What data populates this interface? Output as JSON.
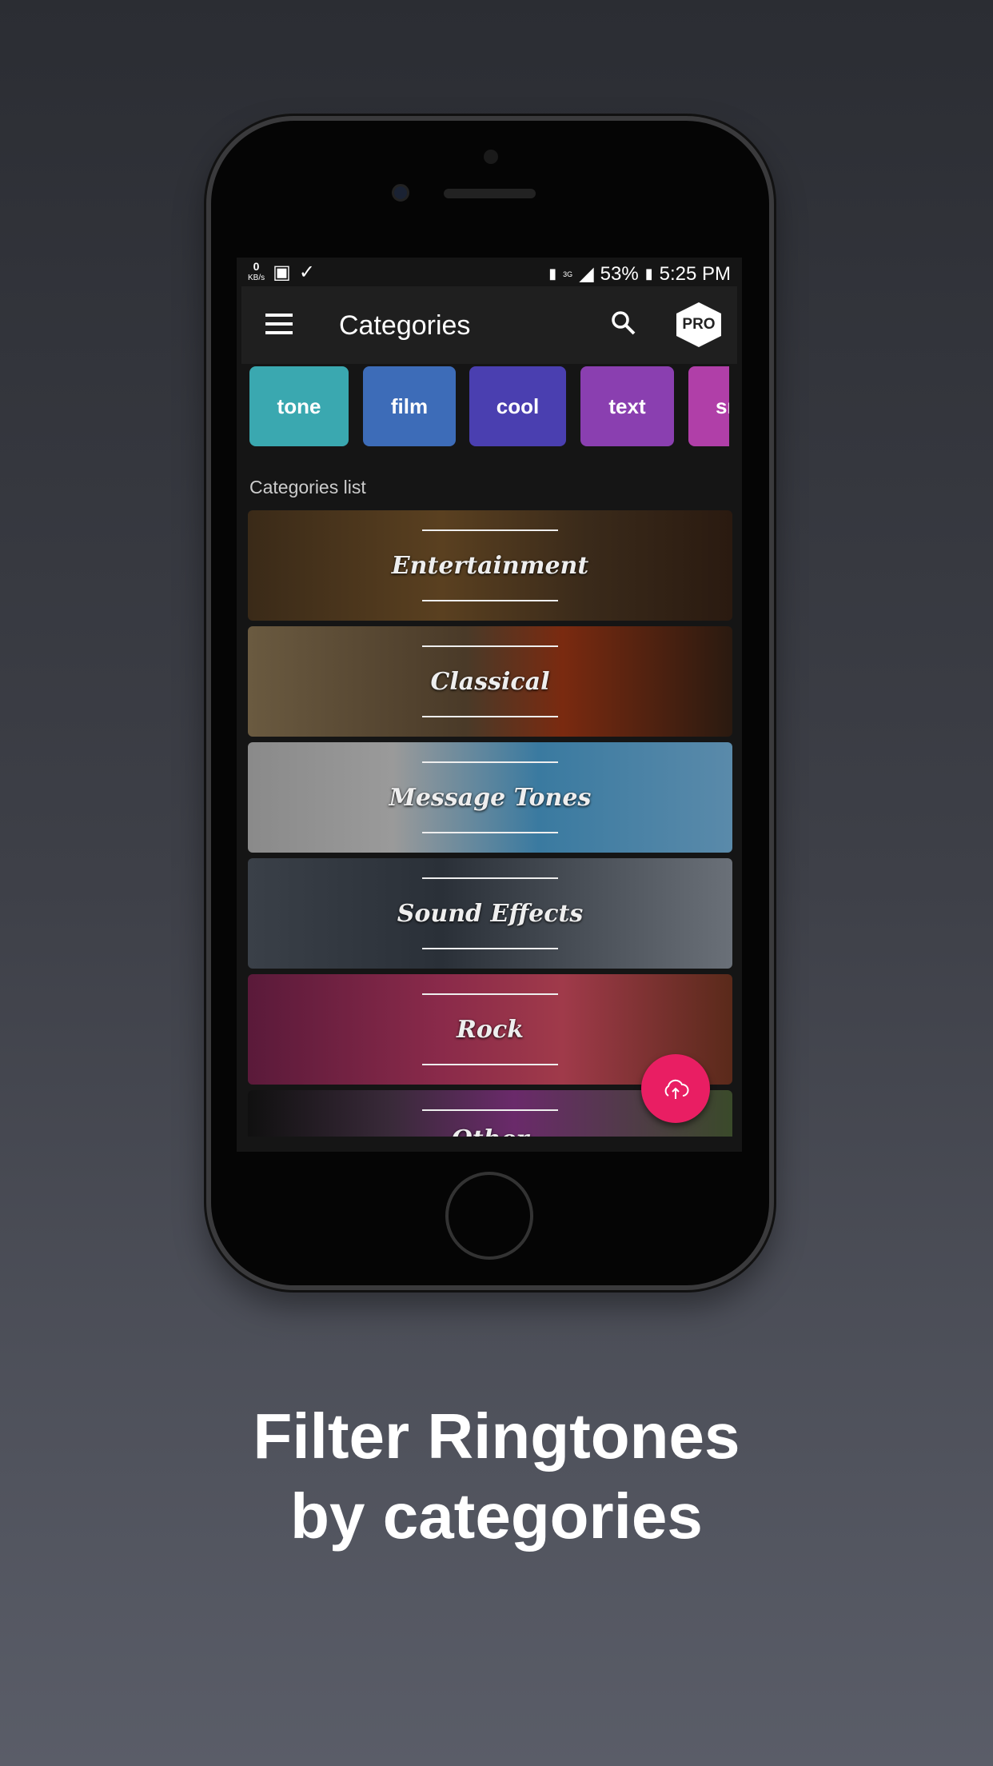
{
  "status": {
    "kbs": "0",
    "kbs_unit": "KB/s",
    "network": "3G",
    "battery": "53%",
    "time": "5:25 PM"
  },
  "toolbar": {
    "title": "Categories",
    "pro": "PRO"
  },
  "chips": [
    {
      "label": "tone",
      "color": "#3aa8b0"
    },
    {
      "label": "film",
      "color": "#3d6cb8"
    },
    {
      "label": "cool",
      "color": "#4a3fb0"
    },
    {
      "label": "text",
      "color": "#8a3fb0"
    },
    {
      "label": "sm",
      "color": "#b03fa8"
    }
  ],
  "section_label": "Categories list",
  "categories": [
    {
      "label": "Entertainment",
      "bg": "linear-gradient(90deg,#3a2a18,#5a4020 40%,#3a2a1a 70%,#2a1a10)"
    },
    {
      "label": "Classical",
      "bg": "linear-gradient(90deg,#6a5a40,#4a3a28 45%,#7a2a10 65%,#2a1a10)"
    },
    {
      "label": "Message Tones",
      "bg": "linear-gradient(90deg,#8a8a8a,#9a9a9a 30%,#3a7aa0 60%,#5a8aaa)"
    },
    {
      "label": "Sound Effects",
      "bg": "linear-gradient(90deg,#3a4048,#2a3038 40%,#4a5058 70%,#6a7078)"
    },
    {
      "label": "Rock",
      "bg": "linear-gradient(90deg,#5a1a3a,#8a2a4a 40%,#a03a4a 65%,#5a2a1a)"
    },
    {
      "label": "Other",
      "bg": "linear-gradient(90deg,#101010,#3a2a3a 30%,#6a2a6a 55%,#3a4a2a)"
    }
  ],
  "caption": {
    "line1": "Filter Ringtones",
    "line2": "by categories"
  },
  "colors": {
    "fab": "#e91e63"
  }
}
